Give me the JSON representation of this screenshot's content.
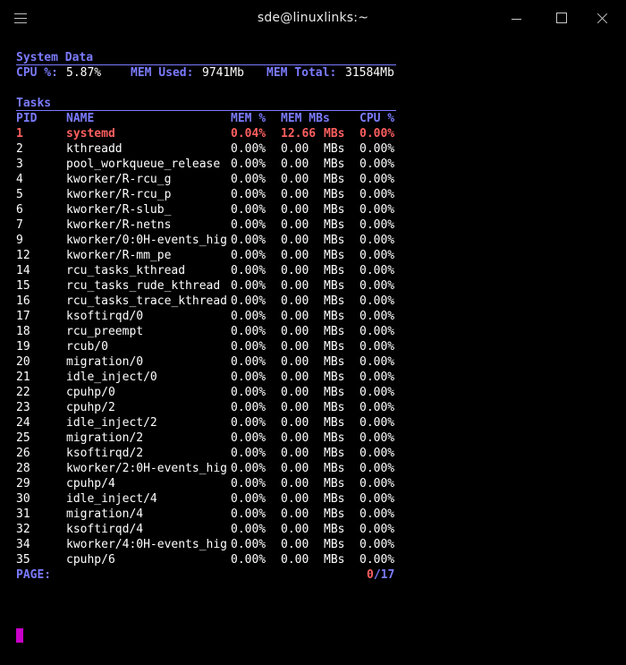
{
  "window": {
    "title": "sde@linuxlinks:~"
  },
  "system": {
    "section_title": "System Data",
    "cpu_label": "CPU %:",
    "cpu_value": "5.87%",
    "mem_used_label": "MEM Used:",
    "mem_used_value": "9741Mb",
    "mem_total_label": "MEM Total:",
    "mem_total_value": "31584Mb"
  },
  "tasks": {
    "section_title": "Tasks",
    "headers": {
      "pid": "PID",
      "name": "NAME",
      "mem_pct": "MEM %",
      "mem_mbs": "MEM MBs",
      "cpu_pct": "CPU %"
    },
    "rows": [
      {
        "pid": "1",
        "name": "systemd",
        "mem_pct": "0.04%",
        "mem_mbs": "12.66",
        "unit": "MBs",
        "cpu_pct": "0.00%",
        "highlight": true
      },
      {
        "pid": "2",
        "name": "kthreadd",
        "mem_pct": "0.00%",
        "mem_mbs": "0.00",
        "unit": "MBs",
        "cpu_pct": "0.00%"
      },
      {
        "pid": "3",
        "name": "pool_workqueue_release",
        "mem_pct": "0.00%",
        "mem_mbs": "0.00",
        "unit": "MBs",
        "cpu_pct": "0.00%"
      },
      {
        "pid": "4",
        "name": "kworker/R-rcu_g",
        "mem_pct": "0.00%",
        "mem_mbs": "0.00",
        "unit": "MBs",
        "cpu_pct": "0.00%"
      },
      {
        "pid": "5",
        "name": "kworker/R-rcu_p",
        "mem_pct": "0.00%",
        "mem_mbs": "0.00",
        "unit": "MBs",
        "cpu_pct": "0.00%"
      },
      {
        "pid": "6",
        "name": "kworker/R-slub_",
        "mem_pct": "0.00%",
        "mem_mbs": "0.00",
        "unit": "MBs",
        "cpu_pct": "0.00%"
      },
      {
        "pid": "7",
        "name": "kworker/R-netns",
        "mem_pct": "0.00%",
        "mem_mbs": "0.00",
        "unit": "MBs",
        "cpu_pct": "0.00%"
      },
      {
        "pid": "9",
        "name": "kworker/0:0H-events_hig",
        "mem_pct": "0.00%",
        "mem_mbs": "0.00",
        "unit": "MBs",
        "cpu_pct": "0.00%"
      },
      {
        "pid": "12",
        "name": "kworker/R-mm_pe",
        "mem_pct": "0.00%",
        "mem_mbs": "0.00",
        "unit": "MBs",
        "cpu_pct": "0.00%"
      },
      {
        "pid": "14",
        "name": "rcu_tasks_kthread",
        "mem_pct": "0.00%",
        "mem_mbs": "0.00",
        "unit": "MBs",
        "cpu_pct": "0.00%"
      },
      {
        "pid": "15",
        "name": "rcu_tasks_rude_kthread",
        "mem_pct": "0.00%",
        "mem_mbs": "0.00",
        "unit": "MBs",
        "cpu_pct": "0.00%"
      },
      {
        "pid": "16",
        "name": "rcu_tasks_trace_kthread",
        "mem_pct": "0.00%",
        "mem_mbs": "0.00",
        "unit": "MBs",
        "cpu_pct": "0.00%"
      },
      {
        "pid": "17",
        "name": "ksoftirqd/0",
        "mem_pct": "0.00%",
        "mem_mbs": "0.00",
        "unit": "MBs",
        "cpu_pct": "0.00%"
      },
      {
        "pid": "18",
        "name": "rcu_preempt",
        "mem_pct": "0.00%",
        "mem_mbs": "0.00",
        "unit": "MBs",
        "cpu_pct": "0.00%"
      },
      {
        "pid": "19",
        "name": "rcub/0",
        "mem_pct": "0.00%",
        "mem_mbs": "0.00",
        "unit": "MBs",
        "cpu_pct": "0.00%"
      },
      {
        "pid": "20",
        "name": "migration/0",
        "mem_pct": "0.00%",
        "mem_mbs": "0.00",
        "unit": "MBs",
        "cpu_pct": "0.00%"
      },
      {
        "pid": "21",
        "name": "idle_inject/0",
        "mem_pct": "0.00%",
        "mem_mbs": "0.00",
        "unit": "MBs",
        "cpu_pct": "0.00%"
      },
      {
        "pid": "22",
        "name": "cpuhp/0",
        "mem_pct": "0.00%",
        "mem_mbs": "0.00",
        "unit": "MBs",
        "cpu_pct": "0.00%"
      },
      {
        "pid": "23",
        "name": "cpuhp/2",
        "mem_pct": "0.00%",
        "mem_mbs": "0.00",
        "unit": "MBs",
        "cpu_pct": "0.00%"
      },
      {
        "pid": "24",
        "name": "idle_inject/2",
        "mem_pct": "0.00%",
        "mem_mbs": "0.00",
        "unit": "MBs",
        "cpu_pct": "0.00%"
      },
      {
        "pid": "25",
        "name": "migration/2",
        "mem_pct": "0.00%",
        "mem_mbs": "0.00",
        "unit": "MBs",
        "cpu_pct": "0.00%"
      },
      {
        "pid": "26",
        "name": "ksoftirqd/2",
        "mem_pct": "0.00%",
        "mem_mbs": "0.00",
        "unit": "MBs",
        "cpu_pct": "0.00%"
      },
      {
        "pid": "28",
        "name": "kworker/2:0H-events_hig",
        "mem_pct": "0.00%",
        "mem_mbs": "0.00",
        "unit": "MBs",
        "cpu_pct": "0.00%"
      },
      {
        "pid": "29",
        "name": "cpuhp/4",
        "mem_pct": "0.00%",
        "mem_mbs": "0.00",
        "unit": "MBs",
        "cpu_pct": "0.00%"
      },
      {
        "pid": "30",
        "name": "idle_inject/4",
        "mem_pct": "0.00%",
        "mem_mbs": "0.00",
        "unit": "MBs",
        "cpu_pct": "0.00%"
      },
      {
        "pid": "31",
        "name": "migration/4",
        "mem_pct": "0.00%",
        "mem_mbs": "0.00",
        "unit": "MBs",
        "cpu_pct": "0.00%"
      },
      {
        "pid": "32",
        "name": "ksoftirqd/4",
        "mem_pct": "0.00%",
        "mem_mbs": "0.00",
        "unit": "MBs",
        "cpu_pct": "0.00%"
      },
      {
        "pid": "34",
        "name": "kworker/4:0H-events_hig",
        "mem_pct": "0.00%",
        "mem_mbs": "0.00",
        "unit": "MBs",
        "cpu_pct": "0.00%"
      },
      {
        "pid": "35",
        "name": "cpuhp/6",
        "mem_pct": "0.00%",
        "mem_mbs": "0.00",
        "unit": "MBs",
        "cpu_pct": "0.00%"
      }
    ]
  },
  "pager": {
    "label": "PAGE:",
    "current": "0",
    "separator": "/",
    "total": "17"
  },
  "colors": {
    "accent": "#7b7bff",
    "highlight": "#ff5f5f",
    "cursor": "#c800c8",
    "text": "#ffffff",
    "background": "#000000"
  }
}
